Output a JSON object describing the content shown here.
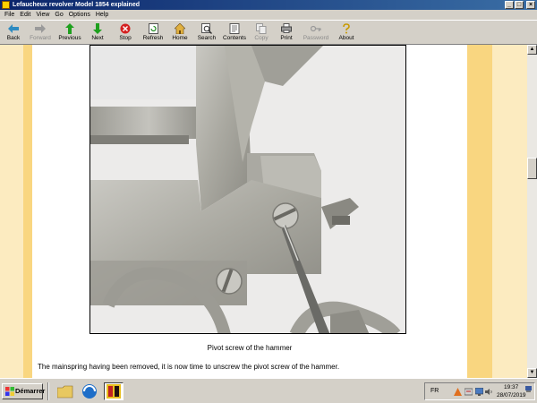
{
  "window": {
    "title": "Lefaucheux revolver Model 1854 explained",
    "controls": {
      "minimize": "_",
      "maximize": "□",
      "close": "×"
    }
  },
  "menu": [
    "File",
    "Edit",
    "View",
    "Go",
    "Options",
    "Help"
  ],
  "toolbar": {
    "back": "Back",
    "forward": "Forward",
    "previous": "Previous",
    "next": "Next",
    "stop": "Stop",
    "refresh": "Refresh",
    "home": "Home",
    "search": "Search",
    "contents": "Contents",
    "copy": "Copy",
    "print": "Print",
    "password": "Password",
    "about": "About"
  },
  "page": {
    "caption": "Pivot screw of the hammer",
    "paragraph": "The mainspring having been removed, it is now time to unscrew the pivot screw of the hammer."
  },
  "scrollbar": {
    "up": "▲",
    "down": "▼"
  },
  "taskbar": {
    "start": "Démarrer",
    "language": "FR",
    "time": "19:37",
    "date": "28/07/2019"
  },
  "colors": {
    "page_bg": "#fcebc0",
    "stripe": "#f9d680",
    "title_bar": "#0a246a"
  }
}
